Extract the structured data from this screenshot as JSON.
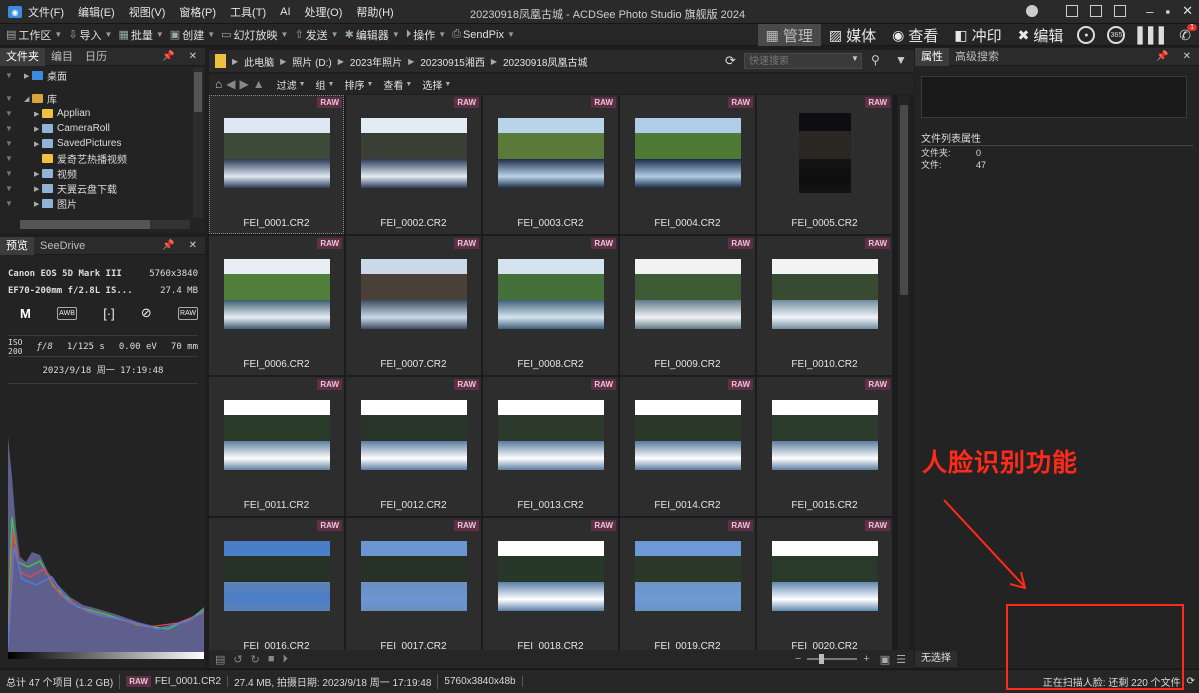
{
  "app": {
    "title": "20230918凤凰古城 - ACDSee Photo Studio 旗舰版 2024",
    "menu": [
      "文件(F)",
      "编辑(E)",
      "视图(V)",
      "窗格(P)",
      "工具(T)",
      "AI",
      "处理(O)",
      "帮助(H)"
    ]
  },
  "toolbar": {
    "workspace": "工作区",
    "import": "导入",
    "batch": "批量",
    "create": "创建",
    "slideshow": "幻灯放映",
    "send": "发送",
    "editor": "编辑器",
    "actions": "操作",
    "sendpix": "SendPix"
  },
  "modes": {
    "manage": "管理",
    "media": "媒体",
    "view": "查看",
    "develop": "冲印",
    "edit": "编辑",
    "badge_365": "365",
    "notif_count": "1"
  },
  "left_panel": {
    "tabs": [
      "文件夹",
      "编目",
      "日历"
    ],
    "tree": [
      {
        "label": "桌面",
        "indent": 1
      },
      {
        "label": "库",
        "indent": 1
      },
      {
        "label": "Applian",
        "indent": 2
      },
      {
        "label": "CameraRoll",
        "indent": 2
      },
      {
        "label": "SavedPictures",
        "indent": 2
      },
      {
        "label": "爱奇艺热播视频",
        "indent": 2
      },
      {
        "label": "视频",
        "indent": 2
      },
      {
        "label": "天翼云盘下载",
        "indent": 2
      },
      {
        "label": "图片",
        "indent": 2
      }
    ]
  },
  "preview": {
    "tabs": [
      "预览",
      "SeeDrive"
    ],
    "camera": "Canon EOS 5D Mark III",
    "resolution": "5760x3840",
    "lens": "EF70-200mm f/2.8L IS...",
    "size": "27.4 MB",
    "mode": "M",
    "awb": "AWB",
    "raw": "RAW",
    "iso_label": "ISO",
    "iso_value": "200",
    "aperture": "ƒ/8",
    "shutter": "1/125 s",
    "ev": "0.00 eV",
    "focal": "70 mm",
    "datetime": "2023/9/18 周一 17:19:48"
  },
  "path": {
    "crumbs": [
      "此电脑",
      "照片 (D:)",
      "2023年照片",
      "20230915湘西",
      "20230918凤凰古城"
    ],
    "search_placeholder": "快速搜索"
  },
  "filters": [
    "过滤",
    "组",
    "排序",
    "查看",
    "选择"
  ],
  "thumbnails": {
    "badge": "RAW",
    "files": [
      "FEI_0001.CR2",
      "FEI_0002.CR2",
      "FEI_0003.CR2",
      "FEI_0004.CR2",
      "FEI_0005.CR2",
      "FEI_0006.CR2",
      "FEI_0007.CR2",
      "FEI_0008.CR2",
      "FEI_0009.CR2",
      "FEI_0010.CR2",
      "FEI_0011.CR2",
      "FEI_0012.CR2",
      "FEI_0013.CR2",
      "FEI_0014.CR2",
      "FEI_0015.CR2",
      "FEI_0016.CR2",
      "FEI_0017.CR2",
      "FEI_0018.CR2",
      "FEI_0019.CR2",
      "FEI_0020.CR2"
    ]
  },
  "right_panel": {
    "tabs": [
      "属性",
      "高级搜索"
    ],
    "section": "文件列表属性",
    "folders_label": "文件夹:",
    "folders_value": "0",
    "files_label": "文件:",
    "files_value": "47",
    "selection": "无选择"
  },
  "status": {
    "total": "总计 47 个项目 (1.2 GB)",
    "raw": "RAW",
    "current": "FEI_0001.CR2",
    "info": "27.4 MB, 拍摄日期: 2023/9/18 周一 17:19:48",
    "dims": "5760x3840x48b",
    "face_scan": "正在扫描人脸: 还剩 220 个文件"
  },
  "annotation": {
    "label": "人脸识别功能",
    "color": "#ff2a1a"
  },
  "colors": {
    "raw_badge": "#5e2f47",
    "background": "#1e1e1e",
    "accent_blue": "#3b8de0"
  }
}
